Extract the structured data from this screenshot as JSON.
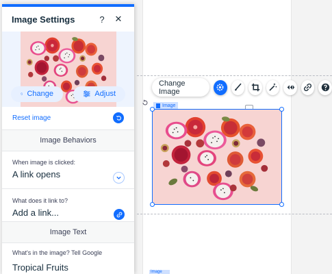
{
  "panel": {
    "title": "Image Settings",
    "help_glyph": "?",
    "close_glyph": "✕",
    "change_label": "Change",
    "adjust_label": "Adjust",
    "reset_label": "Reset image",
    "behaviors_header": "Image Behaviors",
    "click_label": "When image is clicked:",
    "click_value": "A link opens",
    "link_label": "What does it link to?",
    "link_value": "Add a link...",
    "text_header": "Image Text",
    "alt_label": "What's in the image? Tell Google",
    "alt_value": "Tropical Fruits"
  },
  "toolbar": {
    "change_image_label": "Change Image",
    "buttons": [
      "settings-icon",
      "brush-icon",
      "crop-icon",
      "magic-wand-icon",
      "animation-icon",
      "link-icon",
      "help-icon"
    ]
  },
  "selection": {
    "tag_label": "Image"
  },
  "canvas": {
    "bottom_tag_label": "Image"
  },
  "colors": {
    "accent": "#116dff",
    "image_bg": "#f6cfcf"
  }
}
